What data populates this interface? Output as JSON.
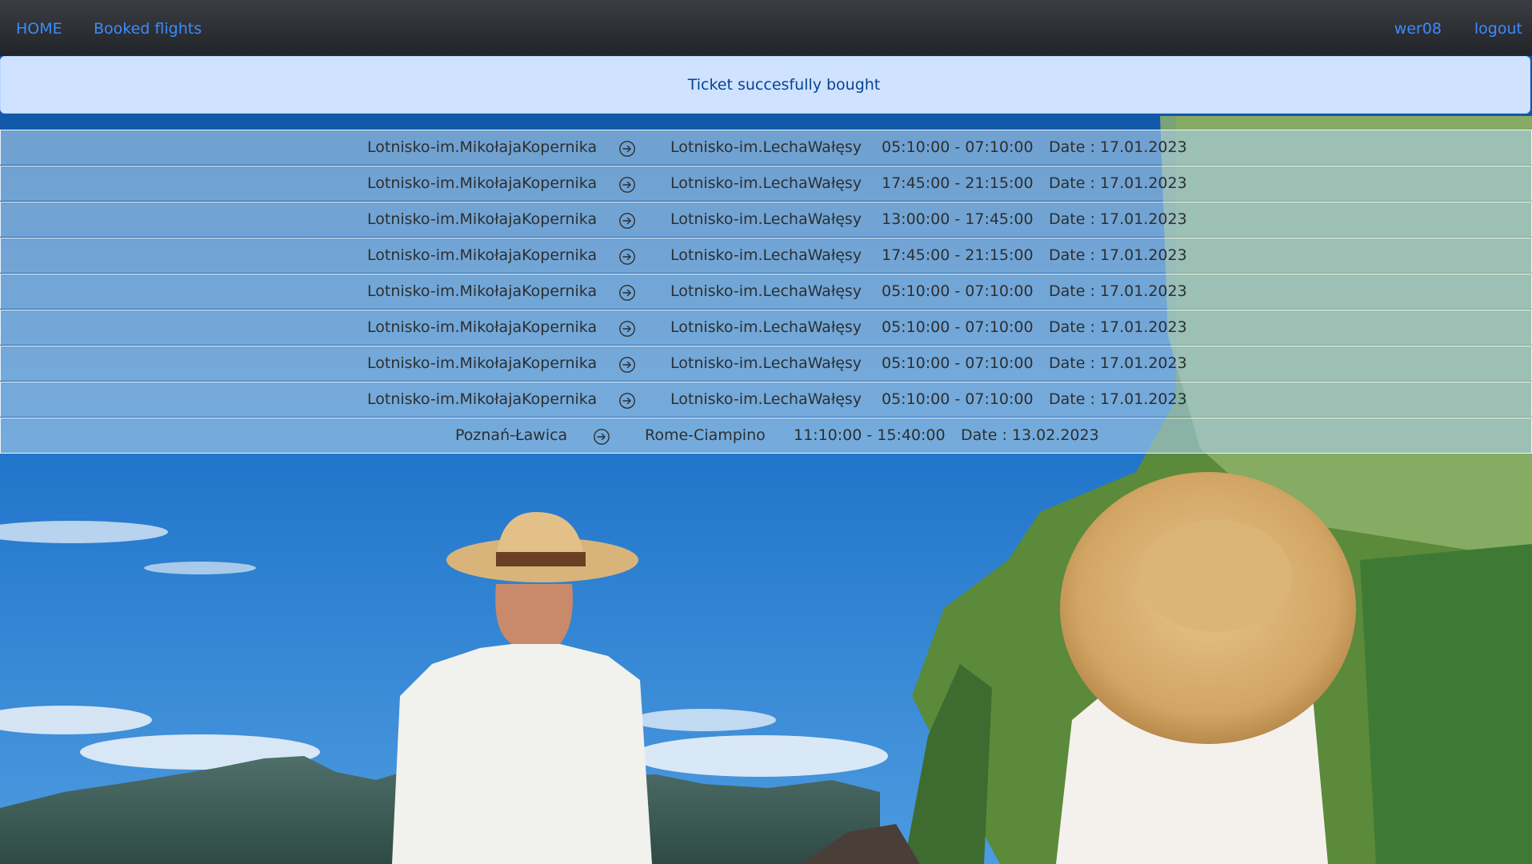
{
  "nav": {
    "home": "HOME",
    "booked": "Booked flights",
    "user": "wer08",
    "logout": "logout",
    "link_color": "#3d8bfd"
  },
  "alert": {
    "message": "Ticket succesfully bought",
    "bg_color": "#cfe2ff",
    "text_color": "#084298"
  },
  "flights": [
    {
      "from": "Lotnisko-im.MikołajaKopernika",
      "to": "Lotnisko-im.LechaWałęsy",
      "time": "05:10:00 - 07:10:00",
      "date": "Date : 17.01.2023",
      "icon": "arrow-right-circle-icon"
    },
    {
      "from": "Lotnisko-im.MikołajaKopernika",
      "to": "Lotnisko-im.LechaWałęsy",
      "time": "17:45:00 - 21:15:00",
      "date": "Date : 17.01.2023",
      "icon": "arrow-right-circle-icon"
    },
    {
      "from": "Lotnisko-im.MikołajaKopernika",
      "to": "Lotnisko-im.LechaWałęsy",
      "time": "13:00:00 - 17:45:00",
      "date": "Date : 17.01.2023",
      "icon": "arrow-right-circle-icon"
    },
    {
      "from": "Lotnisko-im.MikołajaKopernika",
      "to": "Lotnisko-im.LechaWałęsy",
      "time": "17:45:00 - 21:15:00",
      "date": "Date : 17.01.2023",
      "icon": "arrow-right-circle-icon"
    },
    {
      "from": "Lotnisko-im.MikołajaKopernika",
      "to": "Lotnisko-im.LechaWałęsy",
      "time": "05:10:00 - 07:10:00",
      "date": "Date : 17.01.2023",
      "icon": "arrow-right-circle-icon"
    },
    {
      "from": "Lotnisko-im.MikołajaKopernika",
      "to": "Lotnisko-im.LechaWałęsy",
      "time": "05:10:00 - 07:10:00",
      "date": "Date : 17.01.2023",
      "icon": "arrow-right-circle-icon"
    },
    {
      "from": "Lotnisko-im.MikołajaKopernika",
      "to": "Lotnisko-im.LechaWałęsy",
      "time": "05:10:00 - 07:10:00",
      "date": "Date : 17.01.2023",
      "icon": "arrow-right-circle-icon"
    },
    {
      "from": "Lotnisko-im.MikołajaKopernika",
      "to": "Lotnisko-im.LechaWałęsy",
      "time": "05:10:00 - 07:10:00",
      "date": "Date : 17.01.2023",
      "icon": "arrow-right-circle-icon"
    },
    {
      "from": "Poznań-Ławica",
      "to": "Rome-Ciampino",
      "time": "11:10:00 - 15:40:00",
      "date": "Date : 13.02.2023",
      "icon": "arrow-right-circle-icon"
    }
  ]
}
